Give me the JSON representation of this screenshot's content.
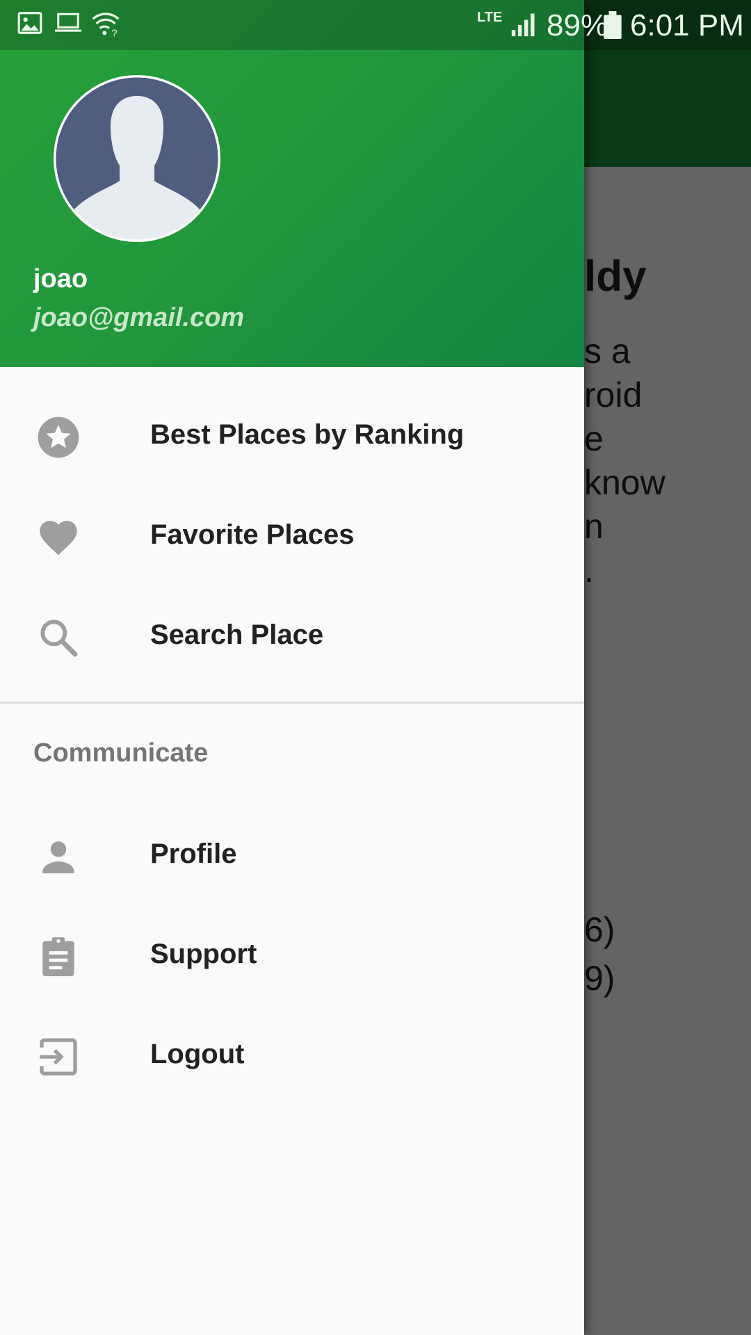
{
  "status_bar": {
    "network": "LTE",
    "battery": "89%",
    "time": "6:01 PM"
  },
  "background_app": {
    "title_fragment": "ldy",
    "body_fragments": [
      "s a",
      "roid",
      "e",
      "know",
      "n",
      "."
    ],
    "meta_fragments": [
      "6)",
      "9)"
    ]
  },
  "drawer": {
    "user": {
      "name": "joao",
      "email": "joao@gmail.com"
    },
    "menu": [
      {
        "label": "Best Places by Ranking",
        "icon": "star-circle-icon"
      },
      {
        "label": "Favorite Places",
        "icon": "heart-icon"
      },
      {
        "label": "Search Place",
        "icon": "search-icon"
      }
    ],
    "section_header": "Communicate",
    "communicate_menu": [
      {
        "label": "Profile",
        "icon": "person-icon"
      },
      {
        "label": "Support",
        "icon": "clipboard-icon"
      },
      {
        "label": "Logout",
        "icon": "logout-icon"
      }
    ]
  },
  "colors": {
    "header_green": "#21963c",
    "toolbar_green": "#1b8e3b",
    "icon_gray": "#9e9e9e"
  }
}
